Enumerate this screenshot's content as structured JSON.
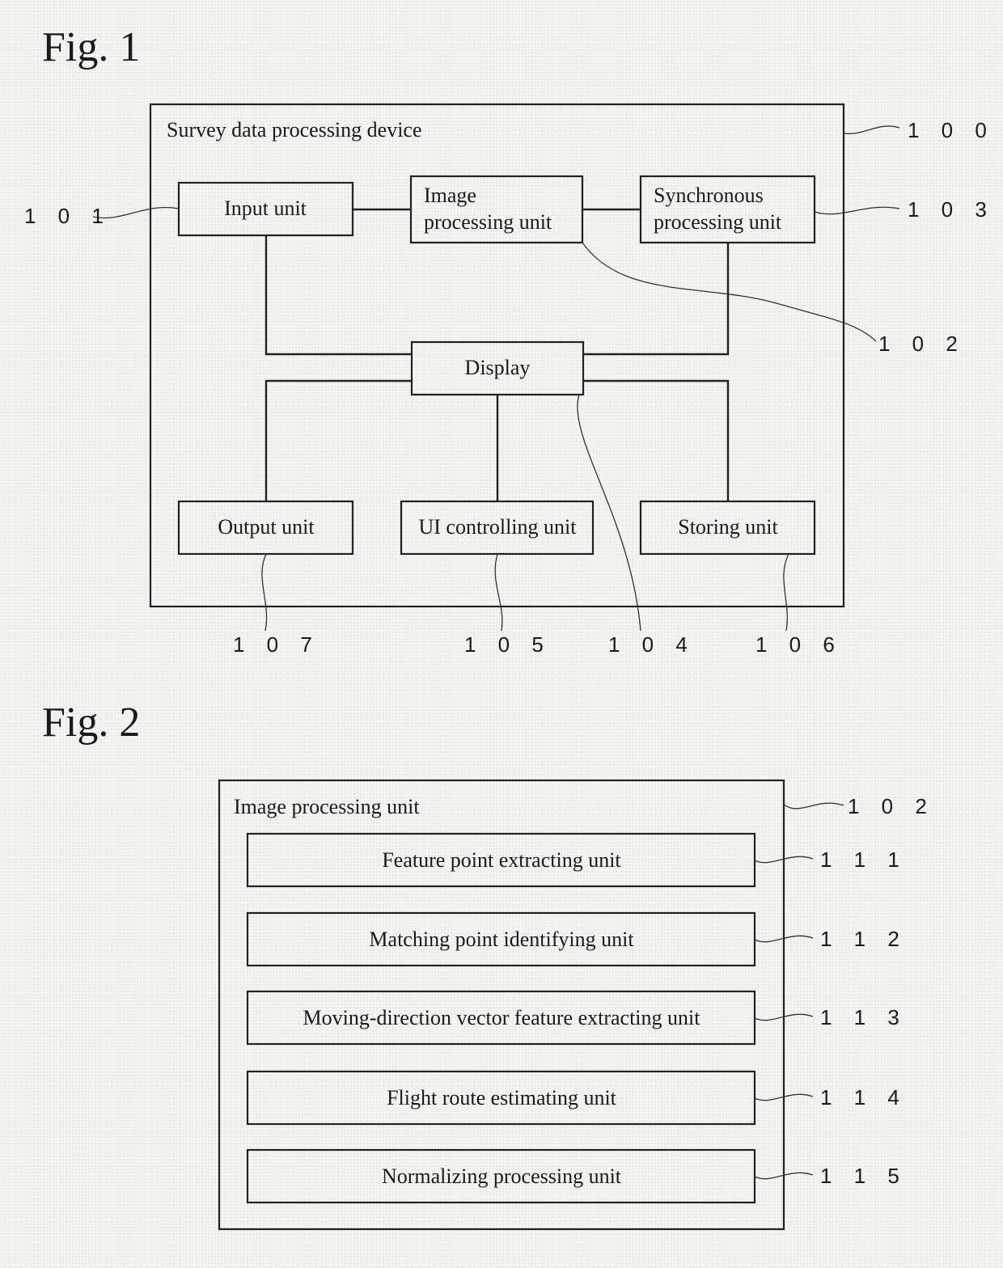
{
  "fig1": {
    "title": "Fig. 1",
    "container": {
      "label": "Survey data processing device",
      "ref": "1 0 0"
    },
    "units": {
      "input": {
        "label": "Input unit",
        "ref": "1 0 1"
      },
      "image": {
        "label_line1": "Image",
        "label_line2": "processing unit",
        "ref": "1 0 2"
      },
      "sync": {
        "label_line1": "Synchronous",
        "label_line2": "processing unit",
        "ref": "1 0 3"
      },
      "display": {
        "label": "Display",
        "ref": "1 0 4"
      },
      "ui": {
        "label": "UI controlling unit",
        "ref": "1 0 5"
      },
      "storing": {
        "label": "Storing unit",
        "ref": "1 0 6"
      },
      "output": {
        "label": "Output unit",
        "ref": "1 0 7"
      }
    }
  },
  "fig2": {
    "title": "Fig. 2",
    "container": {
      "label": "Image processing unit",
      "ref": "1 0 2"
    },
    "units": [
      {
        "label": "Feature point extracting unit",
        "ref": "1 1 1"
      },
      {
        "label": "Matching point identifying unit",
        "ref": "1 1 2"
      },
      {
        "label": "Moving-direction vector feature extracting unit",
        "ref": "1 1 3"
      },
      {
        "label": "Flight route estimating unit",
        "ref": "1 1 4"
      },
      {
        "label": "Normalizing processing unit",
        "ref": "1 1 5"
      }
    ]
  }
}
